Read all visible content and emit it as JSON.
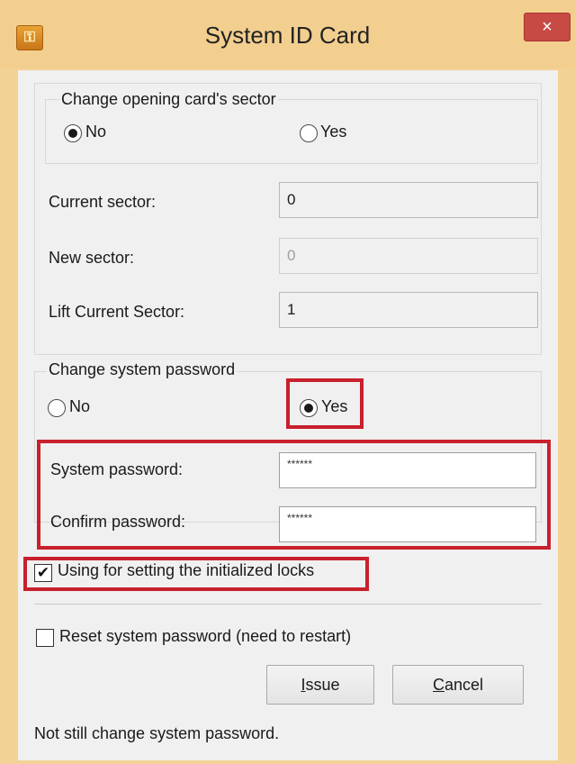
{
  "window": {
    "title": "System ID Card",
    "close_symbol": "×",
    "app_icon": "key-icon"
  },
  "sector_group": {
    "title": "Change opening card's sector",
    "option_no": "No",
    "option_yes": "Yes",
    "selected": "No"
  },
  "fields": {
    "current_sector_label": "Current sector:",
    "current_sector_value": "0",
    "new_sector_label": "New sector:",
    "new_sector_value": "0",
    "lift_sector_label": "Lift Current Sector:",
    "lift_sector_value": "1"
  },
  "password_group": {
    "title": "Change system password",
    "option_no": "No",
    "option_yes": "Yes",
    "selected": "Yes",
    "system_password_label": "System password:",
    "system_password_value": "******",
    "confirm_password_label": "Confirm password:",
    "confirm_password_value": "******"
  },
  "options": {
    "init_locks_label": "Using for setting the initialized locks",
    "init_locks_checked": true,
    "reset_password_label": "Reset system password (need to restart)",
    "reset_password_checked": false
  },
  "buttons": {
    "issue": "Issue",
    "cancel": "Cancel"
  },
  "status_text": "Not still change system password.",
  "colors": {
    "highlight": "#c8202d",
    "title_bar": "#f2cf8f",
    "close_button": "#c74a44"
  }
}
